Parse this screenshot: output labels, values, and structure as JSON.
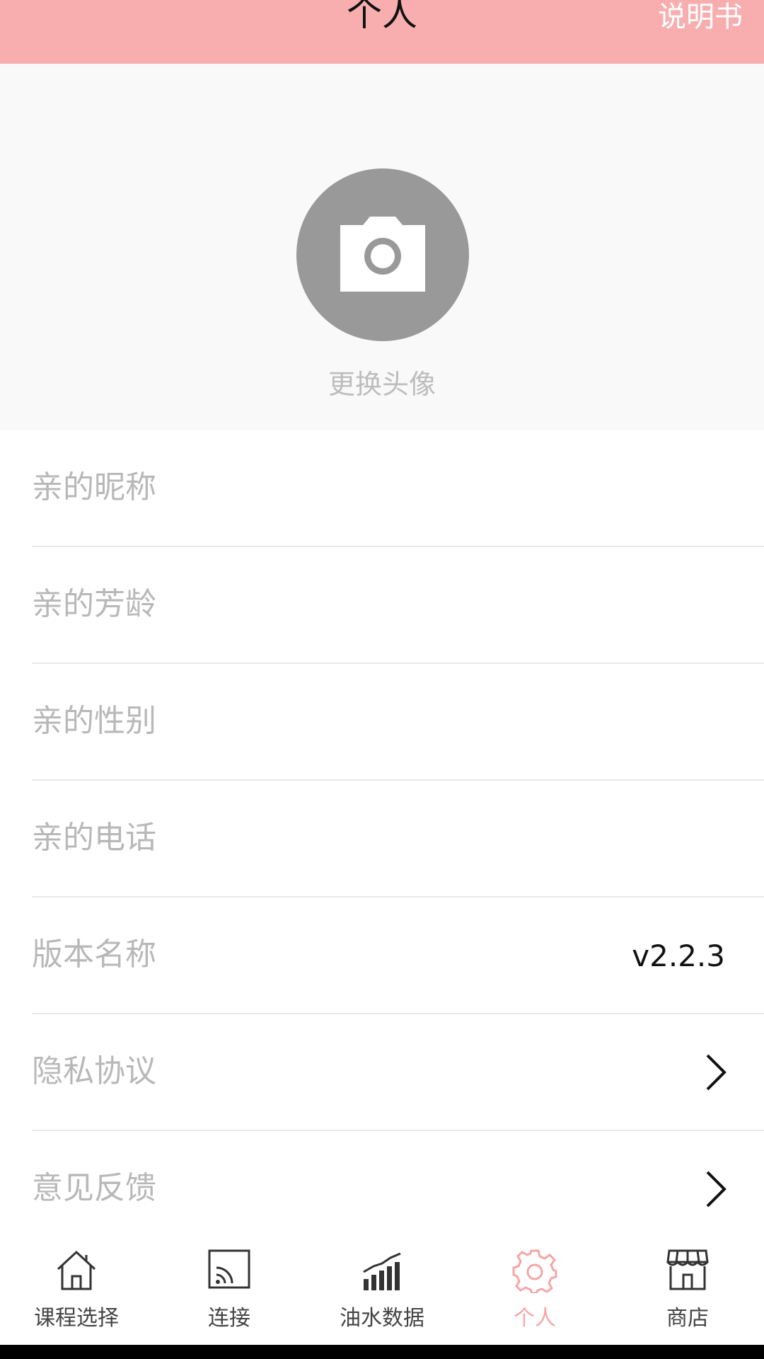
{
  "header": {
    "title": "个人",
    "manual_label": "说明书"
  },
  "avatar": {
    "icon": "camera-icon",
    "change_label": "更换头像"
  },
  "profile_rows": [
    {
      "label": "亲的昵称",
      "value": ""
    },
    {
      "label": "亲的芳龄",
      "value": ""
    },
    {
      "label": "亲的性别",
      "value": ""
    },
    {
      "label": "亲的电话",
      "value": ""
    },
    {
      "label": "版本名称",
      "value": "v2.2.3"
    },
    {
      "label": "隐私协议",
      "icon": "chevron-right-icon"
    },
    {
      "label": "意见反馈",
      "icon": "chevron-right-icon"
    }
  ],
  "tabs": [
    {
      "label": "课程选择",
      "icon": "house-icon"
    },
    {
      "label": "连接",
      "icon": "cast-icon"
    },
    {
      "label": "油水数据",
      "icon": "bar-chart-icon"
    },
    {
      "label": "个人",
      "icon": "gear-icon",
      "active": true
    },
    {
      "label": "商店",
      "icon": "store-icon"
    }
  ],
  "colors": {
    "header_bg": "#f8aeae",
    "active_tab": "#f5a6a6",
    "label_gray": "#b8b8b8",
    "avatar_bg": "#999999"
  }
}
